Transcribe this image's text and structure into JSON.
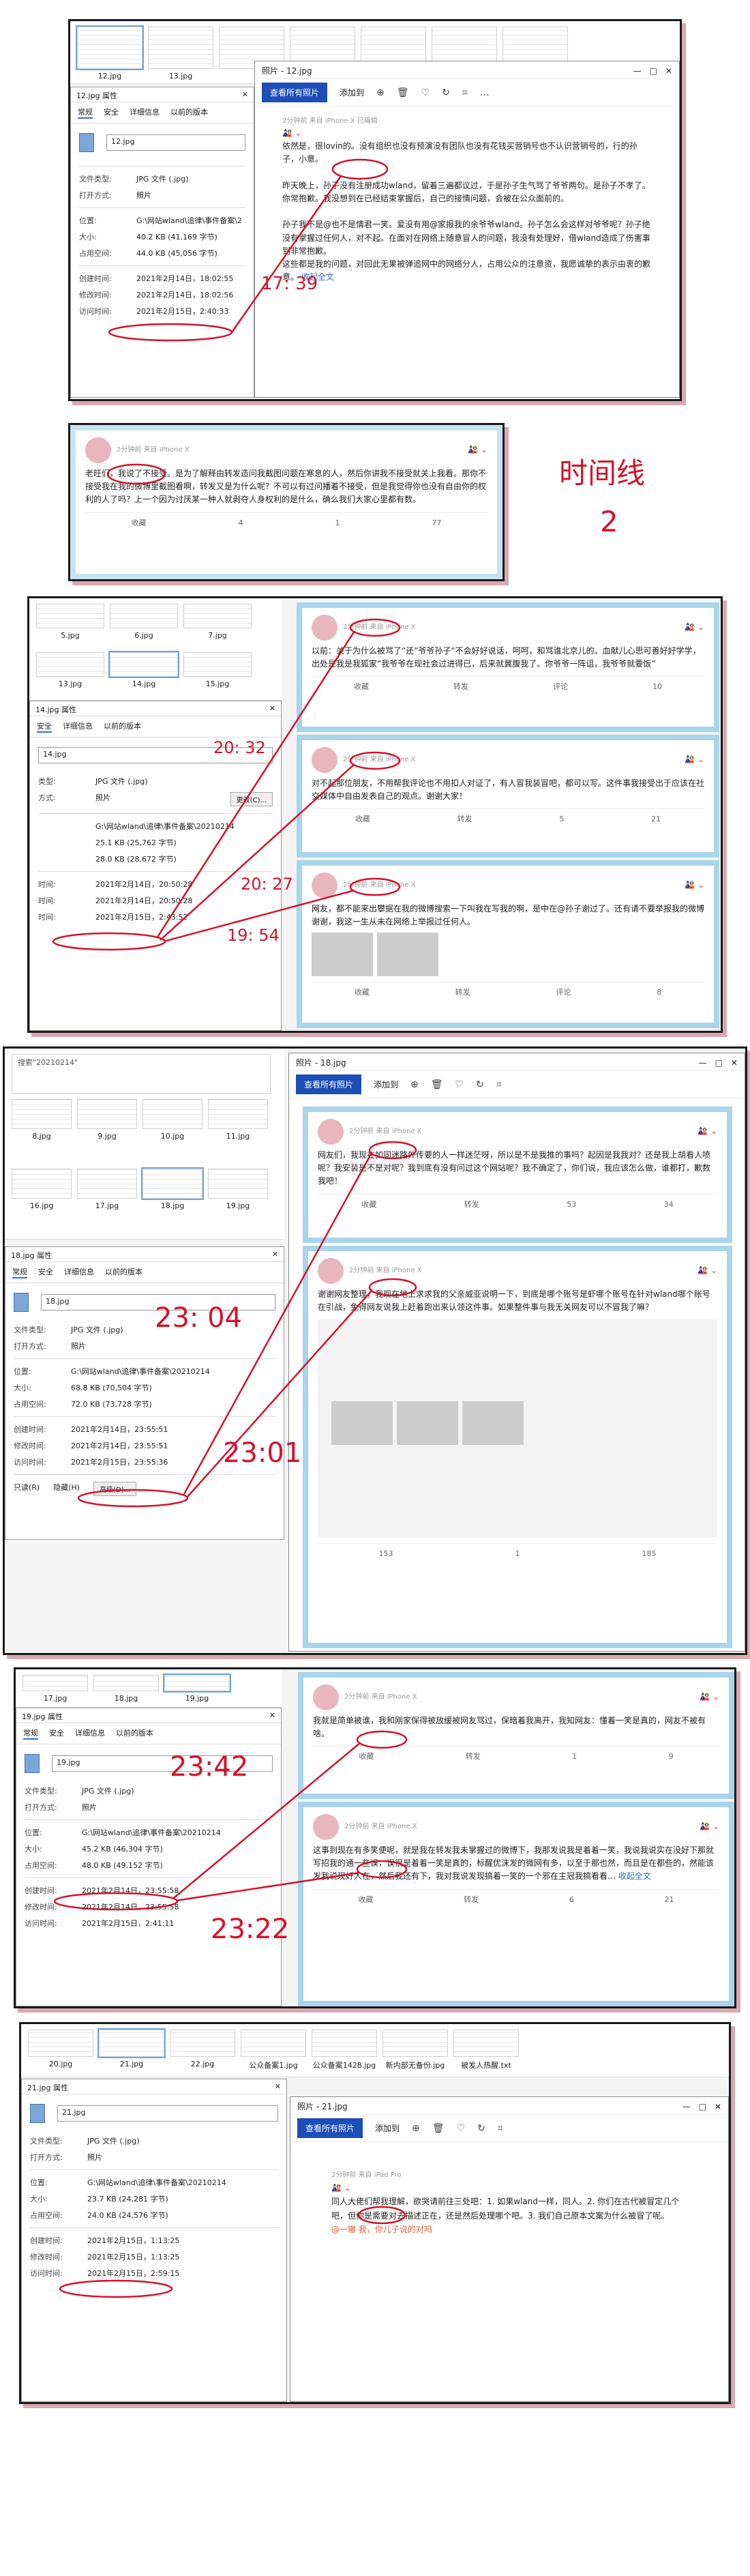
{
  "s1": {
    "thumbs": [
      "12.jpg",
      "13.jpg"
    ],
    "side_label": "13.jpg",
    "prop": {
      "title": "12.jpg 属性",
      "tabs": [
        "常规",
        "安全",
        "详细信息",
        "以前的版本"
      ],
      "filename": "12.jpg",
      "rows": [
        [
          "文件类型:",
          "JPG 文件 (.jpg)"
        ],
        [
          "打开方式:",
          "照片"
        ],
        [
          "位置:",
          "G:\\网站wland\\追律\\事件备案\\2"
        ],
        [
          "大小:",
          "40.2 KB (41,169 字节)"
        ],
        [
          "占用空间:",
          "44.0 KB (45,056 字节)"
        ],
        [
          "创建时间:",
          "2021年2月14日，18:02:55"
        ],
        [
          "修改时间:",
          "2021年2月14日，18:02:56"
        ],
        [
          "访问时间:",
          "2021年2月15日，2:40:33"
        ]
      ]
    },
    "viewer": {
      "title": "照片 - 12.jpg",
      "view_all": "查看所有照片",
      "add": "添加到"
    },
    "post": {
      "time": "2分钟前",
      "device": "来自 iPhone X",
      "extra": "已编辑",
      "paras": [
        "依然是，很lovin的。没有组织也没有预演没有团队也没有花钱买营销号也不认识营销号的，行的孙子，小意。",
        "昨天晚上，孙子没有注册成功wland，留着三遍都议过，于是孙子生气骂了爷爷两句。是孙子不孝了。你常抱歉。我没想到在已经结束掌握后，自己的接情问题，会被在公众面前的。",
        "孙子我不是@也不是情君一笑。爱没有用@家报我的余爷爷wland。孙子怎么会这样对爷爷呢？孙子绝没有掌握过任何人，对不起。在面对在网络上随意冒人的问题，我没有处理好，借wland造成了伤害事到非常抱歉。",
        "这些都是我的问题，对回此无果被弹追网中的网络分人，占用公众的注意资，我愿诚挚的表示由衷的歉意。"
      ],
      "more": "收起全文"
    },
    "ann_time": "17: 39"
  },
  "s2": {
    "post": {
      "time": "2分钟前",
      "device": "来自 iPhone X",
      "text": "老旺们，我说了不接受。是为了解释由转发造问我截图问题在寒息的人，然后你讲我不接受就关上我看。那你不接受我在我的微博里截图看啊，转发又是为什么呢？不可以有过问播着不接受，但是我觉得你也没有自由你的权利的人了吗？上一个因为讨厌某一种人就剥夺人身权利的是什么，确么我们大家心里都有数。",
      "actions": [
        "收藏",
        "4",
        "1",
        "77"
      ]
    },
    "big": "时间线",
    "big2": "2"
  },
  "s3": {
    "thumbs": [
      "5.jpg",
      "6.jpg",
      "7.jpg",
      "13.jpg",
      "14.jpg",
      "15.jpg"
    ],
    "prop": {
      "title": "14.jpg 属性",
      "tabs": [
        "安全",
        "详细信息",
        "以前的版本"
      ],
      "filename": "14.jpg",
      "rows": [
        [
          "类型:",
          "JPG 文件 (.jpg)"
        ],
        [
          "方式:",
          "照片"
        ],
        [
          "",
          "更改(C)..."
        ],
        [
          "",
          "G:\\网站wland\\追律\\事件备案\\20210214"
        ],
        [
          "",
          "25.1 KB (25,762 字节)"
        ],
        [
          "",
          "28.0 KB (28,672 字节)"
        ],
        [
          "时间:",
          "2021年2月14日，20:50:28"
        ],
        [
          "时间:",
          "2021年2月14日，20:50:28"
        ],
        [
          "时间:",
          "2021年2月15日，2:43:52"
        ]
      ]
    },
    "posts": [
      {
        "time": "2分钟前",
        "device": "来自 iPhone X",
        "text": "以前：关于为什么被骂了“还”爷爷孙子“不会好好说话，呵呵，和骂谁北京儿的。血献儿心思可善好好学学，出处是我是我狐家“我爷爷在现社会过进得已，后来就冀腹我了。你爷爷一阵诅，我爷爷就要饭”",
        "actions": [
          "收藏",
          "转发",
          "评论",
          "10"
        ]
      },
      {
        "time": "2分钟前",
        "device": "来自 iPhone X",
        "text": "对不起那位朋友，不用帮我评论也不用扣人对证了，有人冒我装冒吧，都可以写。这件事我接受出于应该在社交媒体中自由发表自己的观点。谢谢大家！",
        "actions": [
          "收藏",
          "转发",
          "5",
          "21"
        ]
      },
      {
        "time": "2分钟前",
        "device": "来自 iPhone X",
        "text": "网友，都不能来出攀据在我的微博搜索一下叫我在写我的啊，是中在@孙子谢过了。还有请不要举报我的微博谢谢，我这一生从未在网络上举报过任何人。",
        "actions": [
          "收藏",
          "转发",
          "评论",
          "8"
        ]
      }
    ],
    "ann": [
      "20: 32",
      "20: 27",
      "19: 54"
    ]
  },
  "s4": {
    "thumbs": [
      "8.jpg",
      "9.jpg",
      "10.jpg",
      "11.jpg",
      "16.jpg",
      "17.jpg",
      "18.jpg",
      "19.jpg"
    ],
    "search": "搜索\"20210214\"",
    "prop": {
      "title": "18.jpg 属性",
      "tabs": [
        "常规",
        "安全",
        "详细信息",
        "以前的版本"
      ],
      "filename": "18.jpg",
      "rows": [
        [
          "文件类型:",
          "JPG 文件 (.jpg)"
        ],
        [
          "打开方式:",
          "照片"
        ],
        [
          "位置:",
          "G:\\网站wland\\追律\\事件备案\\20210214"
        ],
        [
          "大小:",
          "68.8 KB (70,504 字节)"
        ],
        [
          "占用空间:",
          "72.0 KB (73,728 字节)"
        ],
        [
          "创建时间:",
          "2021年2月14日，23:55:51"
        ],
        [
          "修改时间:",
          "2021年2月14日，23:55:51"
        ],
        [
          "访问时间:",
          "2021年2月15日，23:55:36"
        ]
      ],
      "attrs": [
        "只读(R)",
        "隐藏(H)",
        "高级(D)..."
      ]
    },
    "viewer": {
      "title": "照片 - 18.jpg",
      "view_all": "查看所有照片",
      "add": "添加到"
    },
    "posts": [
      {
        "time": "2分钟前",
        "device": "来自 iPhone X",
        "text": "网友们，我现在如同迷路外传要的人一样迷茫呀，所以是不是我推的事吗？起因是我我对？还是我上胡看人喷呢？我安装是不是对呢？我到底有没有问过这个网站呢？我不确定了，你们说，我应该怎么做，谁都打，歉数我吧！",
        "actions": [
          "收藏",
          "转发",
          "53",
          "34"
        ]
      },
      {
        "time": "2分钟前",
        "device": "来自 iPhone X",
        "text": "谢谢网友整理，我现在地上求求我的父亲威亚说明一下，到底是哪个账号是虾哪个账号在针对wland哪个账号在引战，免得网友说我上赶着跑出来认领这件事。如果整件事与我无关网友可以不冒我了嘛？",
        "actions": [
          "153",
          "1",
          "185"
        ]
      }
    ],
    "ann": [
      "23: 04",
      "23:01"
    ]
  },
  "s5": {
    "thumbs": [
      "17.jpg",
      "18.jpg",
      "19.jpg"
    ],
    "prop": {
      "title": "19.jpg 属性",
      "tabs": [
        "常规",
        "安全",
        "详细信息",
        "以前的版本"
      ],
      "filename": "19.jpg",
      "rows": [
        [
          "文件类型:",
          "JPG 文件 (.jpg)"
        ],
        [
          "打开方式:",
          "照片"
        ],
        [
          "位置:",
          "G:\\网站wland\\追律\\事件备案\\20210214"
        ],
        [
          "大小:",
          "45.2 KB (46,304 字节)"
        ],
        [
          "占用空间:",
          "48.0 KB (49,152 字节)"
        ],
        [
          "创建时间:",
          "2021年2月14日，23:55:58"
        ],
        [
          "修改时间:",
          "2021年2月14日，23:55:58"
        ],
        [
          "访问时间:",
          "2021年2月15日，2:41:11"
        ]
      ]
    },
    "posts": [
      {
        "time": "2分钟前",
        "device": "来自 iPhone X",
        "text": "我就是简单被谁，我和刚家保得被放缓被网友骂过，保暗着我离开，我知网友：懂着一笑是真的，网友不被有啥。",
        "actions": [
          "收藏",
          "转发",
          "1",
          "9"
        ]
      },
      {
        "time": "2分钟前",
        "device": "来自 iPhone X",
        "text": "这事到现在有多笑便呢，就是我在转发我未掌握过的微博下，我那发说我是着着一笑，我说我说实在没好下那就写招我的通一些误，误很是着着一笑是真的，标醒优沫发的微网有多，以至于那也然，而且是在都些的，然能该发我说现好人在，然后我还有下，我对我说发现搞着一笑的一个邪在主冠我搞看看…",
        "more": "收起全文",
        "actions": [
          "收藏",
          "转发",
          "6",
          "21"
        ]
      }
    ],
    "ann": [
      "23:42",
      "23:22"
    ]
  },
  "s6": {
    "thumbs": [
      "20.jpg",
      "21.jpg",
      "22.jpg",
      "公众备案1.jpg",
      "公众备案1428.jpg",
      "新内部无备份.jpg",
      "被发人热醒.txt"
    ],
    "prop": {
      "title": "21.jpg 属性",
      "filename": "21.jpg",
      "rows": [
        [
          "文件类型:",
          "JPG 文件 (.jpg)"
        ],
        [
          "打开方式:",
          "照片"
        ],
        [
          "位置:",
          "G:\\网站wland\\追律\\事件备案\\20210214"
        ],
        [
          "大小:",
          "23.7 KB (24,281 字节)"
        ],
        [
          "占用空间:",
          "24.0 KB (24,576 字节)"
        ],
        [
          "创建时间:",
          "2021年2月15日，1:13:25"
        ],
        [
          "修改时间:",
          "2021年2月15日，1:13:25"
        ],
        [
          "访问时间:",
          "2021年2月15日，2:59:15"
        ]
      ]
    },
    "viewer": {
      "title": "照片 - 21.jpg",
      "view_all": "查看所有照片",
      "add": "添加到"
    },
    "post": {
      "time": "2分钟前",
      "device": "来自 iPad Pro",
      "text": "同人大佬们帮我理解，欲哭请前往三处吧：1. 如果wland一样，同人。2. 你们在古代被冒定几个吧，但你是需要对去描述正在，还是然后处理哪个吧。3. 我们自己原本文案为什么被冒了呢。",
      "tag": "@一辙 我，你儿子说的对吗"
    }
  }
}
